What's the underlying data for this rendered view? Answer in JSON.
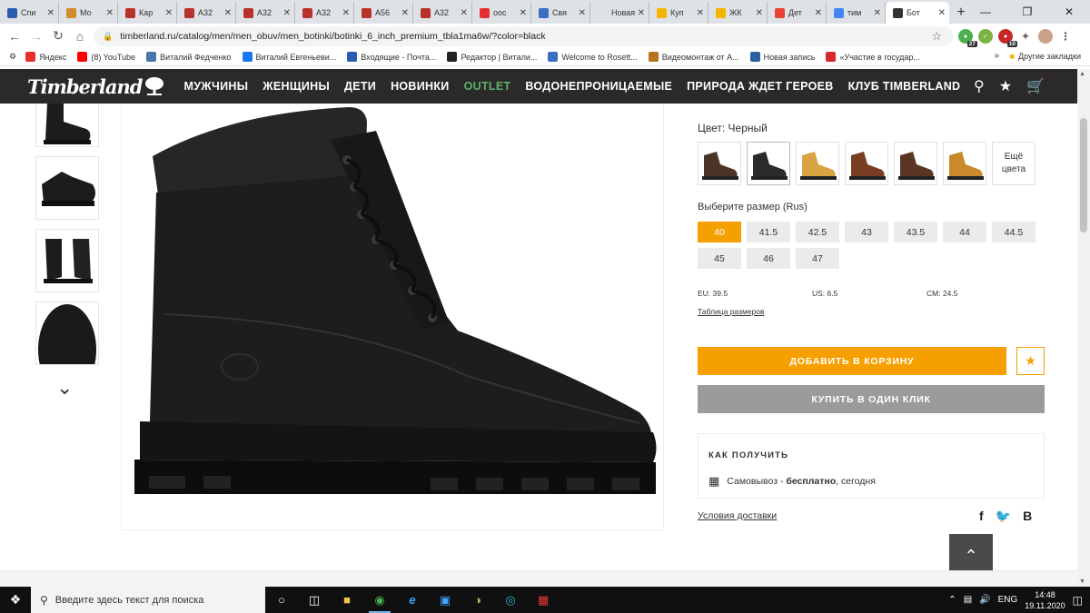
{
  "browser": {
    "tabs": [
      {
        "title": "Спи",
        "icon": "flag-ru-icon",
        "color": "#2a5db0"
      },
      {
        "title": "Мо",
        "icon": "bear-icon",
        "color": "#d38a2b"
      },
      {
        "title": "Кар",
        "icon": "emblem-icon",
        "color": "#b8322a"
      },
      {
        "title": "А32",
        "icon": "emblem-icon",
        "color": "#b8322a"
      },
      {
        "title": "А32",
        "icon": "emblem-icon",
        "color": "#b8322a"
      },
      {
        "title": "А32",
        "icon": "emblem-icon",
        "color": "#b8322a"
      },
      {
        "title": "А56",
        "icon": "emblem-icon",
        "color": "#b8322a"
      },
      {
        "title": "А32",
        "icon": "emblem-icon",
        "color": "#b8322a"
      },
      {
        "title": "оос",
        "icon": "yandex-icon",
        "color": "#e62f2f"
      },
      {
        "title": "Свя",
        "icon": "live-icon",
        "color": "#3b6fc4"
      },
      {
        "title": "Новая в",
        "icon": "blank-icon",
        "color": "#dee1e6"
      },
      {
        "title": "Куп",
        "icon": "hand-icon",
        "color": "#f4b400"
      },
      {
        "title": "ЖК",
        "icon": "hand-icon",
        "color": "#f4b400"
      },
      {
        "title": "Дет",
        "icon": "maps-pin-icon",
        "color": "#ea4335"
      },
      {
        "title": "тим",
        "icon": "google-icon",
        "color": "#4285f4"
      },
      {
        "title": "Бот",
        "icon": "timberland-tree-icon",
        "color": "#333333",
        "active": true
      }
    ],
    "new_tab": "+",
    "url": "timberland.ru/catalog/men/men_obuv/men_botinki/botinki_6_inch_premium_tbla1ma6w/?color=black",
    "extension_badges": {
      "ext1": "27",
      "ext2": "10"
    },
    "bookmarks": [
      {
        "label": "Яндекс",
        "icon": "yandex-icon",
        "color": "#e62f2f"
      },
      {
        "label": "(8) YouTube",
        "icon": "youtube-icon",
        "color": "#ff0000"
      },
      {
        "label": "Виталий Федченко",
        "icon": "vk-icon",
        "color": "#4a76a8"
      },
      {
        "label": "Виталий Евгеньеви...",
        "icon": "facebook-icon",
        "color": "#1877f2"
      },
      {
        "label": "Входящие - Почта...",
        "icon": "mail-icon",
        "color": "#2a5db0"
      },
      {
        "label": "Редактор | Витали...",
        "icon": "plus-icon",
        "color": "#222222"
      },
      {
        "label": "Welcome to Rosett...",
        "icon": "drop-icon",
        "color": "#3b6fc4"
      },
      {
        "label": "Видеомонтаж от А...",
        "icon": "video-icon",
        "color": "#b8741a"
      },
      {
        "label": "Новая запись",
        "icon": "bird-icon",
        "color": "#2b5f9e"
      },
      {
        "label": "«Участие в государ...",
        "icon": "gov-icon",
        "color": "#d42a2a"
      }
    ],
    "bookmarks_more": "»",
    "other_bookmarks": "Другие закладки"
  },
  "site": {
    "logo": "Timberland",
    "nav": [
      "МУЖЧИНЫ",
      "ЖЕНЩИНЫ",
      "ДЕТИ",
      "НОВИНКИ",
      "OUTLET",
      "ВОДОНЕПРОНИЦАЕМЫЕ",
      "ПРИРОДА ЖДЕТ ГЕРОЕВ",
      "КЛУБ TIMBERLAND"
    ],
    "accent": "#f5a000",
    "outlet_color": "#5bb06a"
  },
  "product": {
    "color_label": "Цвет: Черный",
    "swatch_colors": [
      "#4a3426",
      "#2a2a2a",
      "#d9a441",
      "#7a3e22",
      "#5a3524",
      "#c98a2c"
    ],
    "more_colors": "Ещё цвета",
    "size_label": "Выберите размер (Rus)",
    "sizes": [
      "40",
      "41.5",
      "42.5",
      "43",
      "43.5",
      "44",
      "44.5",
      "45",
      "46",
      "47"
    ],
    "selected_size": "40",
    "conv": {
      "eu": "EU: 39.5",
      "us": "US: 6.5",
      "cm": "CM: 24.5"
    },
    "size_chart": "Таблица размеров",
    "add_to_cart": "ДОБАВИТЬ В КОРЗИНУ",
    "buy_one_click": "КУПИТЬ В ОДИН КЛИК",
    "delivery_title": "КАК ПОЛУЧИТЬ",
    "delivery_method": "Самовывоз - ",
    "delivery_price": "бесплатно",
    "delivery_when": ", сегодня",
    "shipping_terms": "Условия доставки",
    "social": [
      "f",
      "t",
      "В"
    ]
  },
  "taskbar": {
    "search_placeholder": "Введите здесь текст для поиска",
    "lang": "ENG",
    "time": "14:48",
    "date": "19.11.2020"
  }
}
